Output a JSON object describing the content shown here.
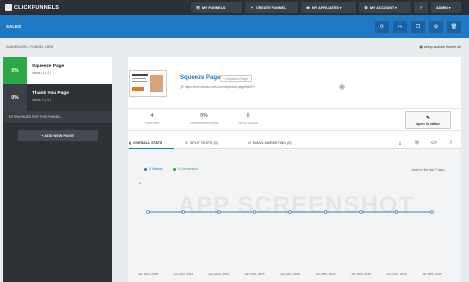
{
  "topnav": {
    "logo": "CLICKFUNNELS",
    "buttons": [
      {
        "icon": "list-icon",
        "glyph": "☰",
        "label": "MY FUNNELS"
      },
      {
        "icon": "plus-icon",
        "glyph": "+",
        "label": "CREATE FUNNEL"
      },
      {
        "icon": "share-icon",
        "glyph": "⇄",
        "label": "MY AFFILIATES ▾"
      },
      {
        "icon": "user-icon",
        "glyph": "⚙",
        "label": "MY ACCOUNT ▾"
      },
      {
        "icon": "question-icon",
        "glyph": "?",
        "label": ""
      },
      {
        "icon": "admin-icon",
        "glyph": "",
        "label": "ADMIN ▾"
      }
    ]
  },
  "header": {
    "title": "SALES",
    "actions": [
      {
        "icon": "refresh-icon",
        "glyph": "⟳"
      },
      {
        "icon": "share-icon",
        "glyph": "↪"
      },
      {
        "icon": "clone-icon",
        "glyph": "❐"
      },
      {
        "icon": "settings-icon",
        "glyph": "⚙"
      },
      {
        "icon": "delete-icon",
        "glyph": "🗑"
      }
    ]
  },
  "breadcrumb": "DASHBOARD   /   FUNNEL VIEW",
  "setup_link": "setup custom funnel url",
  "sidebar": {
    "steps": [
      {
        "pct": "0%",
        "name": "Squeeze Page",
        "views": "views: 4 ( 4 )"
      },
      {
        "pct": "0%",
        "name": "Thank You Page",
        "views": "views: 0 ( 0 )"
      }
    ],
    "extra": "EXTRA PAGES FOR THIS FUNNEL...",
    "add_page": "+  ADD NEW PAGE"
  },
  "page": {
    "name": "Squeeze Page",
    "type": "Squeeze Page",
    "url": "https://test.clickfunnels.com/squeeze-page60697f",
    "stats": [
      {
        "value": "4",
        "label": "VISITORS"
      },
      {
        "value": "0%",
        "label": "CONVERSION RATE"
      },
      {
        "value": "0",
        "label": "TOTAL LEADS"
      }
    ],
    "edit_label": "open in editor"
  },
  "tabs": [
    {
      "icon": "chart-icon",
      "glyph": "▮",
      "label": "OVERALL STATS"
    },
    {
      "icon": "split-icon",
      "glyph": "⇅",
      "label": "SPLIT TESTS (0)"
    },
    {
      "icon": "mail-icon",
      "glyph": "✉",
      "label": "EMAIL MARKETING (0)"
    }
  ],
  "tool_icons": [
    {
      "icon": "download-icon",
      "glyph": "⤓"
    },
    {
      "icon": "wordpress-icon",
      "glyph": "Ⓦ"
    },
    {
      "icon": "code-icon",
      "glyph": "</>"
    },
    {
      "icon": "facebook-icon",
      "glyph": "f"
    }
  ],
  "watermark": "APP SCREENSHOT",
  "chart_data": {
    "type": "line",
    "subtitle": "stats for the last 7 days...",
    "categories": [
      "Jan 20th, 2015",
      "Jan 21st, 2015",
      "Jan 22nd, 2015",
      "Jan 23rd, 2015",
      "Jan 24th, 2015",
      "Jan 25th, 2015",
      "Jan 26th, 2015",
      "Jan 27th, 2015",
      "Jan 28th, 2015"
    ],
    "series": [
      {
        "name": "0 Visitors",
        "color": "#1f78c4",
        "values": [
          0,
          0,
          0,
          0,
          0,
          0,
          0,
          0,
          0
        ]
      },
      {
        "name": "0 Conversion",
        "color": "#2aa846",
        "values": [
          0,
          0,
          0,
          0,
          0,
          0,
          0,
          0,
          0
        ]
      }
    ],
    "y_tick": "0"
  }
}
